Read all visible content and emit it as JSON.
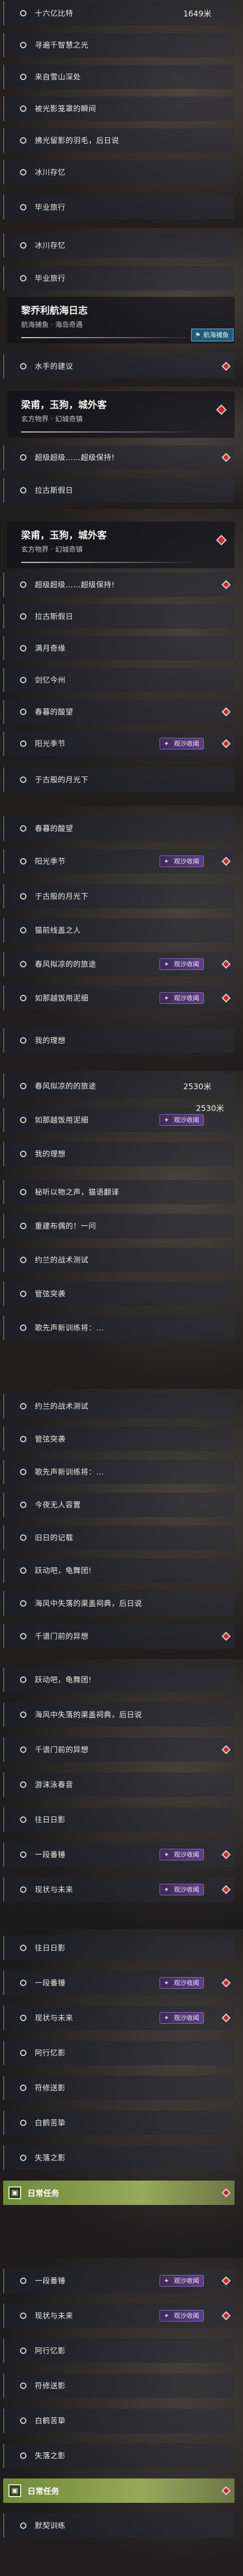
{
  "colors": {
    "accent_marker": "#c0283c",
    "tag_purple": "#5b3f86",
    "tag_blue": "#1f5b78",
    "daily_green": "#6f8a3a"
  },
  "icons": {
    "row_bullet": "circle-bullet-icon",
    "marker": "red-diamond-marker-icon",
    "tag": "sparkle-icon",
    "daily": "calendar-icon"
  },
  "tags": {
    "illusion": "观沙收闻",
    "sea": "航海捕鱼"
  },
  "panel1": {
    "rows": [
      {
        "label": "十六亿比特",
        "dist": "1649米"
      },
      {
        "label": "寻遍千智慧之光"
      },
      {
        "label": "来自雪山深处"
      },
      {
        "label": "被光影笼罩的瞬间"
      },
      {
        "label": "拂光留影的羽毛，后日说"
      },
      {
        "label": "冰川存忆"
      },
      {
        "label": "毕业旅行"
      }
    ]
  },
  "panel2": {
    "rows_top": [
      {
        "label": "冰川存忆"
      },
      {
        "label": "毕业旅行"
      }
    ],
    "header": {
      "title": "黎乔利航海日志",
      "sub": "航海捕鱼 · 海岛奇遇"
    },
    "rows_bottom": [
      {
        "label": "水手的建议"
      }
    ]
  },
  "panel3": {
    "header": {
      "title": "梁甫，玉狗，城外客",
      "sub": "玄方物界 · 幻城奇镇"
    },
    "rows": [
      {
        "label": "超级超级……超级保持!"
      },
      {
        "label": "拉古斯假日"
      }
    ]
  },
  "panel4": {
    "header": {
      "title": "梁甫，玉狗，城外客",
      "sub": "玄方物界 · 幻城奇镇"
    },
    "rows": [
      {
        "label": "超级超级……超级保持!"
      },
      {
        "label": "拉古斯假日"
      },
      {
        "label": "满月奇缘"
      },
      {
        "label": "剑忆今州"
      },
      {
        "label": "春暮的酸望"
      },
      {
        "label": "阳光季节"
      },
      {
        "label": "于古般的月光下"
      }
    ]
  },
  "panel5": {
    "rows": [
      {
        "label": "春暮的酸望"
      },
      {
        "label": "阳光季节"
      },
      {
        "label": "于古般的月光下"
      },
      {
        "label": "猫前线盖之人"
      },
      {
        "label": "春风拟凉的的旅途"
      },
      {
        "label": "如那越饭用泥细"
      },
      {
        "label": "我的理想"
      }
    ]
  },
  "panel6": {
    "rows": [
      {
        "label": "春风拟凉的的旅途",
        "dist": "2530米"
      },
      {
        "label": "如那越饭用泥细",
        "dist": "2530米"
      },
      {
        "label": "我的理想"
      },
      {
        "label": "秘听以物之声，猫语翻译"
      },
      {
        "label": "重建布偶的！一问"
      },
      {
        "label": "约兰的战术测试"
      },
      {
        "label": "管弦突袭"
      },
      {
        "label": "歌先声新训练将：…"
      }
    ]
  },
  "panel7": {
    "rows": [
      {
        "label": "约兰的战术测试"
      },
      {
        "label": "管弦突袭"
      },
      {
        "label": "歌先声新训练将：…"
      },
      {
        "label": "今夜无人容置"
      },
      {
        "label": "旧日的记载"
      },
      {
        "label": "跃动吧，龟舞团!"
      },
      {
        "label": "海风中失落的渠盖祠典，后日说"
      },
      {
        "label": "千谱门前的异想"
      }
    ]
  },
  "panel8": {
    "rows": [
      {
        "label": "跃动吧，龟舞团!"
      },
      {
        "label": "海风中失落的渠盖祠典，后日说"
      },
      {
        "label": "千谱门前的异想"
      },
      {
        "label": "游沫泳春音"
      },
      {
        "label": "往日日影"
      },
      {
        "label": "一段番锤"
      },
      {
        "label": "现状与未来"
      }
    ]
  },
  "panel9": {
    "rows": [
      {
        "label": "往日日影"
      },
      {
        "label": "一段番锤"
      },
      {
        "label": "现状与未来"
      },
      {
        "label": "阿行忆影"
      },
      {
        "label": "符修送影"
      },
      {
        "label": "白鹤苦挚"
      },
      {
        "label": "失落之影"
      }
    ],
    "daily": "日常任务"
  },
  "panel10": {
    "rows": [
      {
        "label": "一段番锤"
      },
      {
        "label": "现状与未来"
      },
      {
        "label": "阿行忆影"
      },
      {
        "label": "符修送影"
      },
      {
        "label": "白鹤苦挚"
      },
      {
        "label": "失落之影"
      }
    ],
    "daily": "日常任务",
    "extra": [
      {
        "label": "默契训练"
      }
    ]
  }
}
